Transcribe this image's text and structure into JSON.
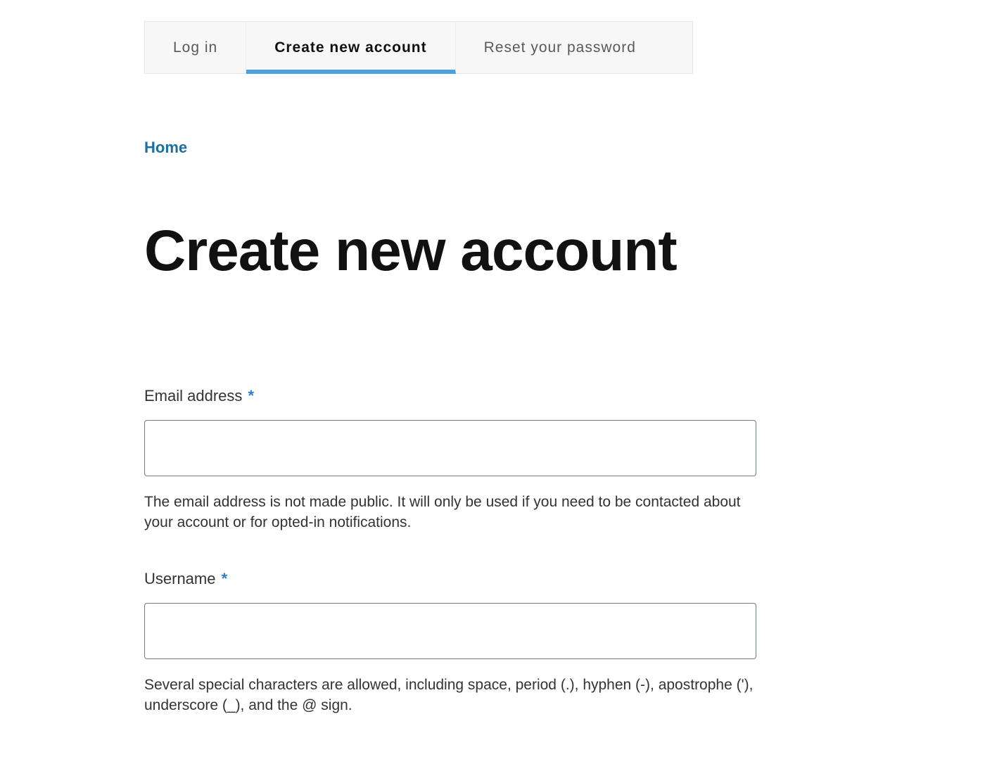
{
  "tabs": {
    "login": "Log in",
    "create": "Create new account",
    "reset": "Reset your password"
  },
  "breadcrumb": {
    "home": "Home"
  },
  "page": {
    "title": "Create new account"
  },
  "form": {
    "email": {
      "label": "Email address",
      "value": "",
      "help": "The email address is not made public. It will only be used if you need to be contacted about your account or for opted-in notifications."
    },
    "username": {
      "label": "Username",
      "value": "",
      "help": "Several special characters are allowed, including space, period (.), hyphen (-), apostrophe ('), underscore (_), and the @ sign."
    },
    "required_marker": "*"
  }
}
